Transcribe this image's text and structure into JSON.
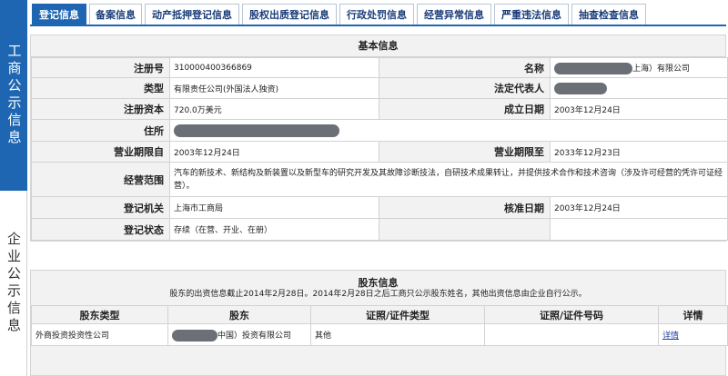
{
  "sidebar": {
    "gongshang": "工商公示信息",
    "qiye": "企业公示信息"
  },
  "tabs": [
    {
      "label": "登记信息"
    },
    {
      "label": "备案信息"
    },
    {
      "label": "动产抵押登记信息"
    },
    {
      "label": "股权出质登记信息"
    },
    {
      "label": "行政处罚信息"
    },
    {
      "label": "经营异常信息"
    },
    {
      "label": "严重违法信息"
    },
    {
      "label": "抽查检查信息"
    }
  ],
  "basic": {
    "title": "基本信息",
    "reg_no_label": "注册号",
    "reg_no": "310000400366869",
    "name_label": "名称",
    "name_suffix": "上海）有限公司",
    "type_label": "类型",
    "type": "有限责任公司(外国法人独资)",
    "legal_rep_label": "法定代表人",
    "capital_label": "注册资本",
    "capital": "720.0万美元",
    "found_date_label": "成立日期",
    "found_date": "2003年12月24日",
    "address_label": "住所",
    "term_from_label": "营业期限自",
    "term_from": "2003年12月24日",
    "term_to_label": "营业期限至",
    "term_to": "2033年12月23日",
    "scope_label": "经营范围",
    "scope": "汽车的新技术、新结构及新装置以及新型车的研究开发及其故障诊断技法，自研技术成果转让，并提供技术合作和技术咨询（涉及许可经营的凭许可证经营）。",
    "authority_label": "登记机关",
    "authority": "上海市工商局",
    "approve_date_label": "核准日期",
    "approve_date": "2003年12月24日",
    "status_label": "登记状态",
    "status": "存续（在营、开业、在册）"
  },
  "shareholders": {
    "title": "股东信息",
    "note": "股东的出资信息截止2014年2月28日。2014年2月28日之后工商只公示股东姓名，其他出资信息由企业自行公示。",
    "headers": [
      "股东类型",
      "股东",
      "证照/证件类型",
      "证照/证件号码",
      "详情"
    ],
    "rows": [
      {
        "type": "外商投资投资性公司",
        "name_suffix": "中国）投资有限公司",
        "id_type": "其他",
        "id_no": "",
        "detail": "详情"
      }
    ]
  }
}
